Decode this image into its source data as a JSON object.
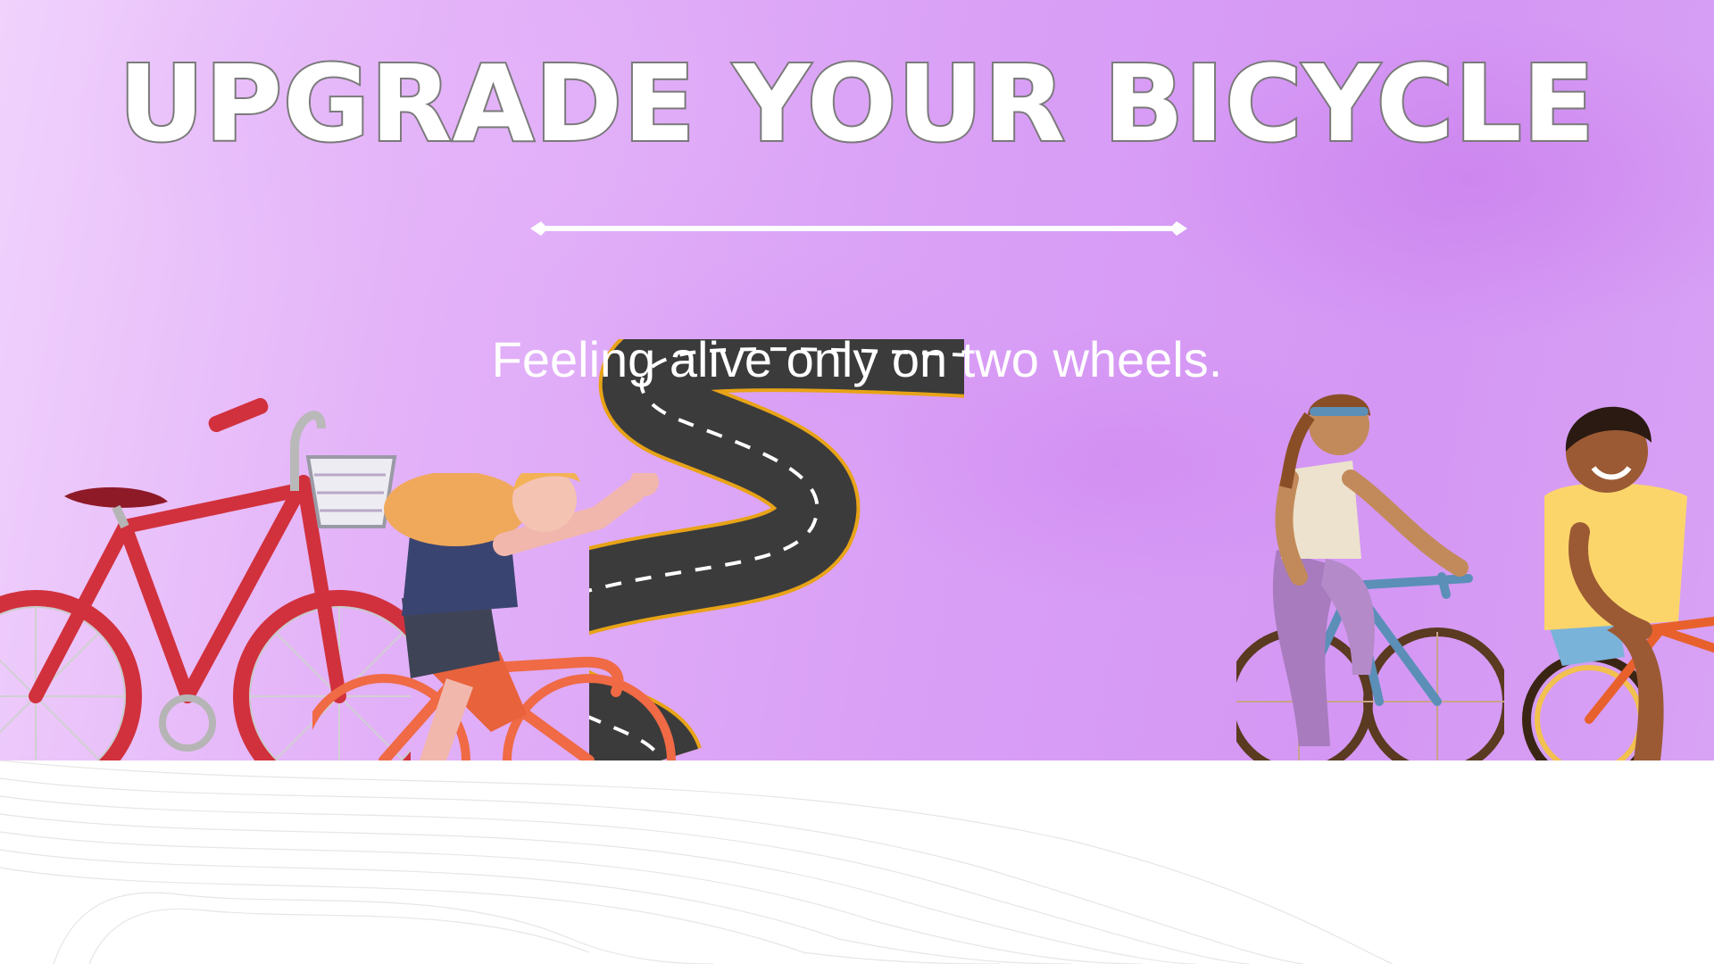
{
  "banner": {
    "title": "UPGRADE YOUR BICYCLE",
    "tagline": "Feeling alive only on two wheels."
  },
  "illustrations": [
    "red-bicycle-icon",
    "waving-cyclist-icon",
    "winding-road-icon",
    "woman-cyclist-icon",
    "man-cyclist-icon"
  ],
  "colors": {
    "background_purple": "#d99ff6",
    "title_fill": "#ffffff",
    "title_outline": "#7a7a7a",
    "road": "#3b3b3b",
    "road_edge": "#e8a317",
    "bicycle_red": "#d1313d",
    "bicycle_orange": "#ef6a45",
    "bicycle_blue": "#5b8fb8"
  }
}
